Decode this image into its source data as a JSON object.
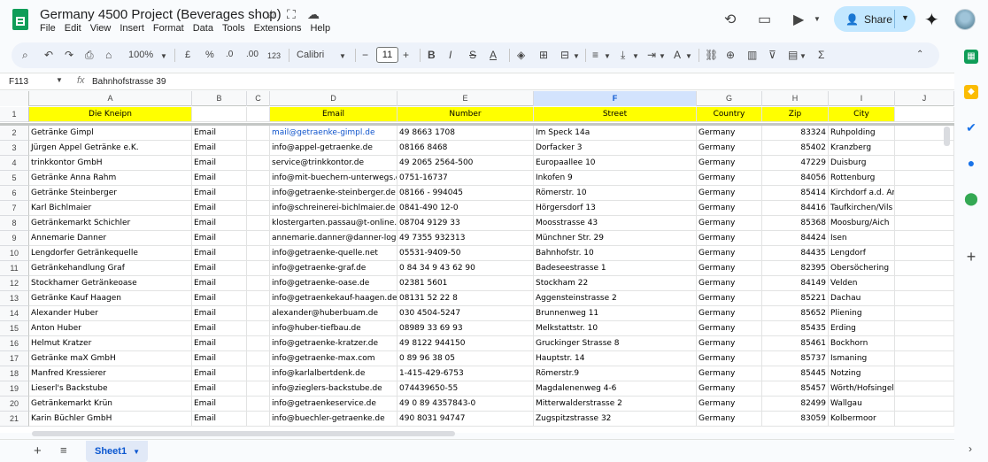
{
  "doc": {
    "title": "Germany 4500 Project (Beverages shop)",
    "menus": [
      "File",
      "Edit",
      "View",
      "Insert",
      "Format",
      "Data",
      "Tools",
      "Extensions",
      "Help"
    ],
    "share_label": "Share"
  },
  "toolbar": {
    "zoom": "100%",
    "currency": "£",
    "percent": "%",
    "dec_decrease": ".0",
    "dec_increase": ".00",
    "more_formats": "123",
    "font": "Calibri",
    "font_size": "11"
  },
  "formula": {
    "cell_ref": "F113",
    "fx": "fx",
    "value": "Bahnhofstrasse 39"
  },
  "columns": [
    "A",
    "B",
    "C",
    "D",
    "E",
    "F",
    "G",
    "H",
    "I",
    "J"
  ],
  "selected_column": "F",
  "header_row": [
    "Die Kneipn",
    "",
    "",
    "Email",
    "Number",
    "Street",
    "Country",
    "Zip",
    "City"
  ],
  "rows": [
    [
      "Getränke Gimpl",
      "Email",
      "",
      "mail@getraenke-gimpl.de",
      "49 8663 1708",
      "Im Speck 14a",
      "Germany",
      "83324",
      "Ruhpolding"
    ],
    [
      "Jürgen Appel Getränke e.K.",
      "Email",
      "",
      "info@appel-getraenke.de",
      "08166 8468",
      "Dorfacker 3",
      "Germany",
      "85402",
      "Kranzberg"
    ],
    [
      "trinkkontor GmbH",
      "Email",
      "",
      "service@trinkkontor.de",
      "49 2065 2564-500",
      "Europaallee 10",
      "Germany",
      "47229",
      "Duisburg"
    ],
    [
      "Getränke Anna Rahm",
      "Email",
      "",
      "info@mit-buechern-unterwegs.d",
      "0751-16737",
      "Inkofen 9",
      "Germany",
      "84056",
      "Rottenburg"
    ],
    [
      "Getränke Steinberger",
      "Email",
      "",
      "info@getraenke-steinberger.de",
      "08166 - 994045",
      "Römerstr. 10",
      "Germany",
      "85414",
      "Kirchdorf a.d. Amper"
    ],
    [
      "Karl Bichlmaier",
      "Email",
      "",
      "info@schreinerei-bichlmaier.de",
      "0841-490 12-0",
      "Hörgersdorf 13",
      "Germany",
      "84416",
      "Taufkirchen/Vils"
    ],
    [
      "Getränkemarkt Schichler",
      "Email",
      "",
      "klostergarten.passau@t-online.c",
      "08704 9129 33",
      "Moosstrasse 43",
      "Germany",
      "85368",
      "Moosburg/Aich"
    ],
    [
      "Annemarie Danner",
      "Email",
      "",
      "annemarie.danner@danner-logi",
      "49 7355 932313",
      "Münchner Str. 29",
      "Germany",
      "84424",
      "Isen"
    ],
    [
      "Lengdorfer Getränkequelle",
      "Email",
      "",
      " info@getraenke-quelle.net",
      "05531-9409-50",
      "Bahnhofstr. 10",
      "Germany",
      "84435",
      "Lengdorf"
    ],
    [
      "Getränkehandlung Graf",
      "Email",
      "",
      "info@getraenke-graf.de",
      "0 84 34  9 43 62 90",
      "Badeseestrasse 1",
      "Germany",
      "82395",
      "Obersöchering"
    ],
    [
      "Stockhamer Getränkeoase",
      "Email",
      "",
      "info@getraenke-oase.de",
      "02381  5601",
      "Stockham 22",
      "Germany",
      "84149",
      "Velden"
    ],
    [
      "Getränke Kauf Haagen",
      "Email",
      "",
      " info@getraenkekauf-haagen.de",
      "08131 52 22 8",
      "Aggensteinstrasse 2",
      "Germany",
      "85221",
      "Dachau"
    ],
    [
      "Alexander Huber",
      "Email",
      "",
      "alexander@huberbuam.de",
      " 030 4504-5247",
      "Brunnenweg 11",
      "Germany",
      "85652",
      "Pliening"
    ],
    [
      "Anton Huber",
      "Email",
      "",
      " info@huber-tiefbau.de",
      "08989 33 69 93",
      "Melkstattstr. 10",
      "Germany",
      "85435",
      "Erding"
    ],
    [
      "Helmut Kratzer",
      "Email",
      "",
      "info@getraenke-kratzer.de",
      "49 8122 944150",
      "Gruckinger Strasse 8",
      "Germany",
      "85461",
      "Bockhorn"
    ],
    [
      "Getränke maX GmbH",
      "Email",
      "",
      "info@getraenke-max.com",
      "0 89 96 38 05",
      "Hauptstr. 14",
      "Germany",
      "85737",
      "Ismaning"
    ],
    [
      "Manfred Kressierer",
      "Email",
      "",
      "info@karlalbertdenk.de",
      "1-415-429-6753",
      "Römerstr.9",
      "Germany",
      "85445",
      "Notzing"
    ],
    [
      "Lieserl's Backstube",
      "Email",
      "",
      "info@zieglers-backstube.de",
      "074439650-55",
      "Magdalenenweg 4-6",
      "Germany",
      "85457",
      "Wörth/Hofsingelding"
    ],
    [
      "Getränkemarkt Krün",
      "Email",
      "",
      "info@getraenkeservice.de",
      "49 0 89 4357843-0",
      "Mitterwalderstrasse 2",
      "Germany",
      "82499",
      "Wallgau"
    ],
    [
      "Karin Büchler GmbH",
      "Email",
      "",
      "info@buechler-getraenke.de",
      "490 8031 94747",
      "Zugspitzstrasse 32",
      "Germany",
      "83059",
      "Kolbermoor"
    ]
  ],
  "sheet": {
    "tab_name": "Sheet1"
  }
}
